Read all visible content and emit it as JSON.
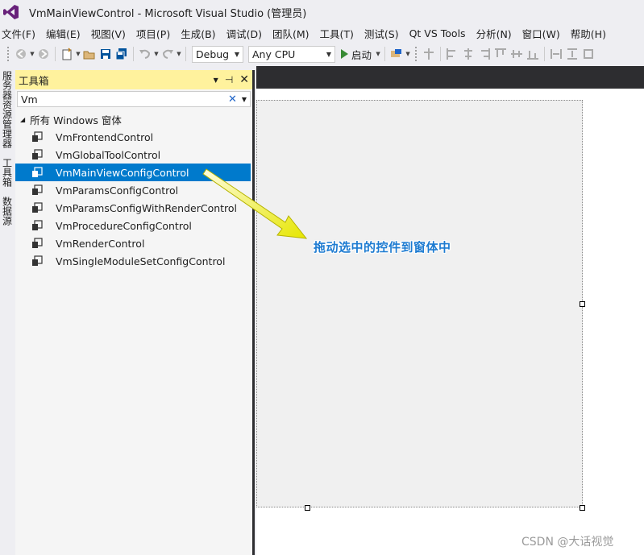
{
  "window": {
    "title": "VmMainViewControl - Microsoft Visual Studio (管理员)"
  },
  "menu": [
    "文件(F)",
    "编辑(E)",
    "视图(V)",
    "项目(P)",
    "生成(B)",
    "调试(D)",
    "团队(M)",
    "工具(T)",
    "测试(S)",
    "Qt VS Tools",
    "分析(N)",
    "窗口(W)",
    "帮助(H)"
  ],
  "toolbar": {
    "configuration": "Debug",
    "platform": "Any CPU",
    "start_label": "启动"
  },
  "side_tabs": [
    "服务器资源管理器",
    "工具箱",
    "数据源"
  ],
  "toolbox": {
    "title": "工具箱",
    "search_value": "Vm",
    "category": "所有 Windows 窗体",
    "items": [
      "VmFrontendControl",
      "VmGlobalToolControl",
      "VmMainViewConfigControl",
      "VmParamsConfigControl",
      "VmParamsConfigWithRenderControl",
      "VmProcedureConfigControl",
      "VmRenderControl",
      "VmSingleModuleSetConfigControl"
    ],
    "selected_index": 2
  },
  "annotation": "拖动选中的控件到窗体中",
  "watermark": "CSDN @大话视觉",
  "colors": {
    "accent": "#007acc",
    "toolbox_header": "#fff29d",
    "dark_bg": "#2d2d30",
    "annotation": "#1d7bd1"
  }
}
